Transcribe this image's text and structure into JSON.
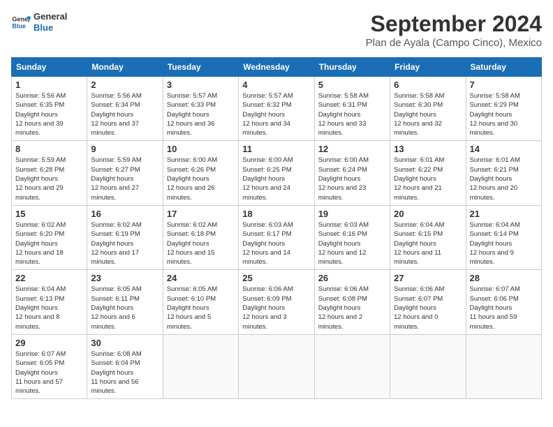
{
  "header": {
    "logo_general": "General",
    "logo_blue": "Blue",
    "month_title": "September 2024",
    "location": "Plan de Ayala (Campo Cinco), Mexico"
  },
  "calendar": {
    "days_of_week": [
      "Sunday",
      "Monday",
      "Tuesday",
      "Wednesday",
      "Thursday",
      "Friday",
      "Saturday"
    ],
    "weeks": [
      [
        null,
        {
          "day": "2",
          "sunrise": "5:56 AM",
          "sunset": "6:34 PM",
          "daylight": "12 hours and 37 minutes."
        },
        {
          "day": "3",
          "sunrise": "5:57 AM",
          "sunset": "6:33 PM",
          "daylight": "12 hours and 36 minutes."
        },
        {
          "day": "4",
          "sunrise": "5:57 AM",
          "sunset": "6:32 PM",
          "daylight": "12 hours and 34 minutes."
        },
        {
          "day": "5",
          "sunrise": "5:58 AM",
          "sunset": "6:31 PM",
          "daylight": "12 hours and 33 minutes."
        },
        {
          "day": "6",
          "sunrise": "5:58 AM",
          "sunset": "6:30 PM",
          "daylight": "12 hours and 32 minutes."
        },
        {
          "day": "7",
          "sunrise": "5:58 AM",
          "sunset": "6:29 PM",
          "daylight": "12 hours and 30 minutes."
        }
      ],
      [
        {
          "day": "1",
          "sunrise": "5:56 AM",
          "sunset": "6:35 PM",
          "daylight": "12 hours and 39 minutes."
        },
        null,
        null,
        null,
        null,
        null,
        null
      ],
      [
        {
          "day": "8",
          "sunrise": "5:59 AM",
          "sunset": "6:28 PM",
          "daylight": "12 hours and 29 minutes."
        },
        {
          "day": "9",
          "sunrise": "5:59 AM",
          "sunset": "6:27 PM",
          "daylight": "12 hours and 27 minutes."
        },
        {
          "day": "10",
          "sunrise": "6:00 AM",
          "sunset": "6:26 PM",
          "daylight": "12 hours and 26 minutes."
        },
        {
          "day": "11",
          "sunrise": "6:00 AM",
          "sunset": "6:25 PM",
          "daylight": "12 hours and 24 minutes."
        },
        {
          "day": "12",
          "sunrise": "6:00 AM",
          "sunset": "6:24 PM",
          "daylight": "12 hours and 23 minutes."
        },
        {
          "day": "13",
          "sunrise": "6:01 AM",
          "sunset": "6:22 PM",
          "daylight": "12 hours and 21 minutes."
        },
        {
          "day": "14",
          "sunrise": "6:01 AM",
          "sunset": "6:21 PM",
          "daylight": "12 hours and 20 minutes."
        }
      ],
      [
        {
          "day": "15",
          "sunrise": "6:02 AM",
          "sunset": "6:20 PM",
          "daylight": "12 hours and 18 minutes."
        },
        {
          "day": "16",
          "sunrise": "6:02 AM",
          "sunset": "6:19 PM",
          "daylight": "12 hours and 17 minutes."
        },
        {
          "day": "17",
          "sunrise": "6:02 AM",
          "sunset": "6:18 PM",
          "daylight": "12 hours and 15 minutes."
        },
        {
          "day": "18",
          "sunrise": "6:03 AM",
          "sunset": "6:17 PM",
          "daylight": "12 hours and 14 minutes."
        },
        {
          "day": "19",
          "sunrise": "6:03 AM",
          "sunset": "6:16 PM",
          "daylight": "12 hours and 12 minutes."
        },
        {
          "day": "20",
          "sunrise": "6:04 AM",
          "sunset": "6:15 PM",
          "daylight": "12 hours and 11 minutes."
        },
        {
          "day": "21",
          "sunrise": "6:04 AM",
          "sunset": "6:14 PM",
          "daylight": "12 hours and 9 minutes."
        }
      ],
      [
        {
          "day": "22",
          "sunrise": "6:04 AM",
          "sunset": "6:13 PM",
          "daylight": "12 hours and 8 minutes."
        },
        {
          "day": "23",
          "sunrise": "6:05 AM",
          "sunset": "6:11 PM",
          "daylight": "12 hours and 6 minutes."
        },
        {
          "day": "24",
          "sunrise": "6:05 AM",
          "sunset": "6:10 PM",
          "daylight": "12 hours and 5 minutes."
        },
        {
          "day": "25",
          "sunrise": "6:06 AM",
          "sunset": "6:09 PM",
          "daylight": "12 hours and 3 minutes."
        },
        {
          "day": "26",
          "sunrise": "6:06 AM",
          "sunset": "6:08 PM",
          "daylight": "12 hours and 2 minutes."
        },
        {
          "day": "27",
          "sunrise": "6:06 AM",
          "sunset": "6:07 PM",
          "daylight": "12 hours and 0 minutes."
        },
        {
          "day": "28",
          "sunrise": "6:07 AM",
          "sunset": "6:06 PM",
          "daylight": "11 hours and 59 minutes."
        }
      ],
      [
        {
          "day": "29",
          "sunrise": "6:07 AM",
          "sunset": "6:05 PM",
          "daylight": "11 hours and 57 minutes."
        },
        {
          "day": "30",
          "sunrise": "6:08 AM",
          "sunset": "6:04 PM",
          "daylight": "11 hours and 56 minutes."
        },
        null,
        null,
        null,
        null,
        null
      ]
    ]
  }
}
